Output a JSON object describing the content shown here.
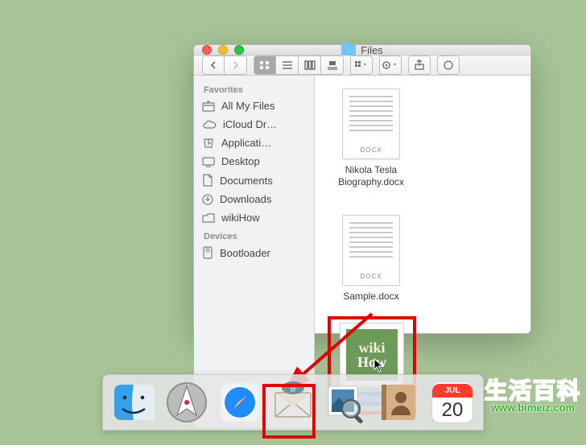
{
  "window": {
    "title": "Files"
  },
  "sidebar": {
    "heading_fav": "Favorites",
    "heading_dev": "Devices",
    "items": [
      {
        "icon": "all-my-files",
        "label": "All My Files"
      },
      {
        "icon": "icloud",
        "label": "iCloud Dr…"
      },
      {
        "icon": "applications",
        "label": "Applicati…"
      },
      {
        "icon": "desktop",
        "label": "Desktop"
      },
      {
        "icon": "documents",
        "label": "Documents"
      },
      {
        "icon": "downloads",
        "label": "Downloads"
      },
      {
        "icon": "folder",
        "label": "wikiHow"
      }
    ],
    "devices": [
      {
        "icon": "disk",
        "label": "Bootloader"
      }
    ]
  },
  "files": {
    "docx_badge": "DOCX",
    "items": [
      {
        "name": "Nikola Tesla Biography.docx",
        "selected": false,
        "kind": "docx"
      },
      {
        "name": "Sample.docx",
        "selected": false,
        "kind": "docx"
      },
      {
        "name": "wikihow.jpg",
        "selected": true,
        "kind": "image",
        "thumb_text_line1": "wiki",
        "thumb_text_line2": "How"
      }
    ]
  },
  "dock": {
    "items": [
      {
        "name": "finder",
        "label": "Finder"
      },
      {
        "name": "launchpad",
        "label": "Launchpad"
      },
      {
        "name": "safari",
        "label": "Safari"
      },
      {
        "name": "mail",
        "label": "Mail"
      },
      {
        "name": "preview",
        "label": "Preview"
      },
      {
        "name": "contacts",
        "label": "Contacts"
      },
      {
        "name": "calendar",
        "label": "Calendar",
        "badge_month": "JUL",
        "badge_day": "20"
      }
    ]
  },
  "watermark": {
    "cn": "生活百科",
    "url": "www.bimeiz.com"
  }
}
